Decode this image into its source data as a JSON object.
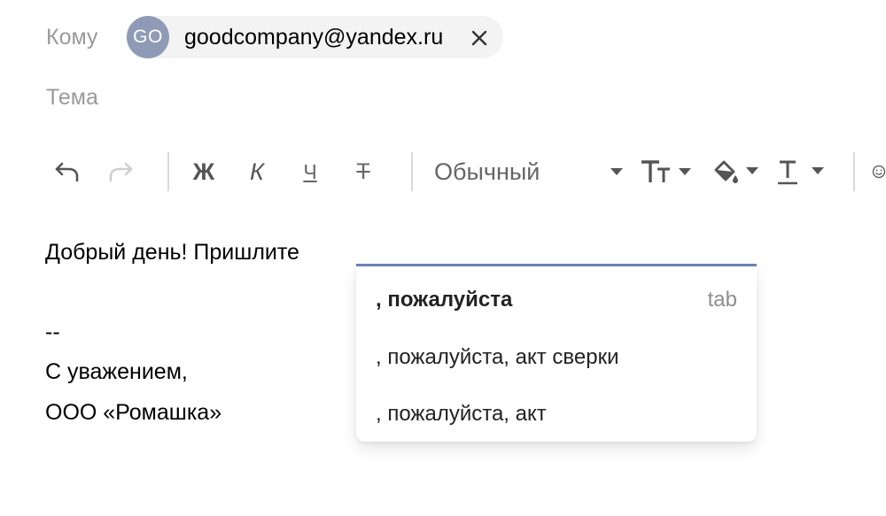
{
  "recipients": {
    "label": "Кому",
    "chip": {
      "initials": "GO",
      "email": "goodcompany@yandex.ru",
      "remove_icon": "close-icon",
      "avatar_color": "#8f9bb6"
    }
  },
  "subject": {
    "placeholder": "Тема"
  },
  "toolbar": {
    "undo_icon": "undo-icon",
    "redo_icon": "redo-icon",
    "bold_label": "Ж",
    "italic_label": "К",
    "underline_label": "Ч",
    "strike_label": "Т",
    "style_select": {
      "value": "Обычный"
    },
    "font_size_icon": "font-size-icon",
    "fill_icon": "paint-bucket-icon",
    "text_color_icon": "text-color-icon",
    "emoji_icon": "emoji-icon"
  },
  "body": {
    "line1": "Добрый день! Пришлите",
    "signature_separator": "--",
    "signature_line1": "С уважением,",
    "signature_line2": "ООО «Ромашка»"
  },
  "autocomplete": {
    "accent_color": "#6b84b6",
    "items": [
      {
        "text": ", пожалуйста",
        "hint": "tab"
      },
      {
        "text": ", пожалуйста, акт сверки"
      },
      {
        "text": ", пожалуйста, акт"
      }
    ]
  }
}
